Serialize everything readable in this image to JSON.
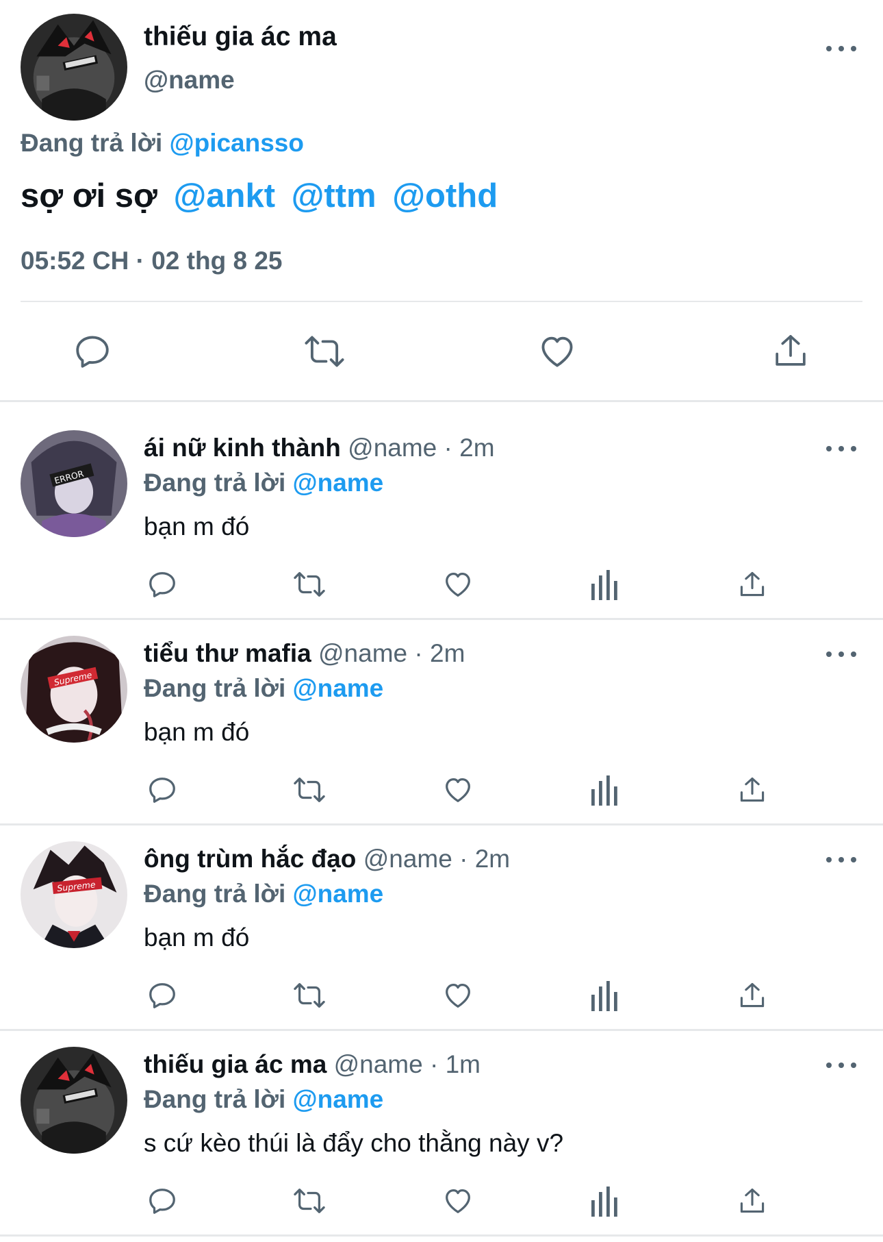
{
  "main_tweet": {
    "author_name": "thiếu gia ác ma",
    "author_handle": "@name",
    "replying_label": "Đang trả lời",
    "replying_to": "@picansso",
    "text_prefix": "sợ ơi sợ",
    "mentions": [
      "@ankt",
      "@ttm",
      "@othd"
    ],
    "timestamp": "05:52 CH · 02 thg 8 25",
    "avatar_icon": "avatar-anime-boy-dark",
    "actions": [
      "reply-icon",
      "retweet-icon",
      "like-icon",
      "share-icon"
    ]
  },
  "replies": [
    {
      "name": "ái nữ kinh thành",
      "handle": "@name",
      "time": "2m",
      "replying_label": "Đang trả lời",
      "replying_to": "@name",
      "text": "bạn m đó",
      "avatar_icon": "avatar-anime-girl-error"
    },
    {
      "name": "tiểu thư mafia",
      "handle": "@name",
      "time": "2m",
      "replying_label": "Đang trả lời",
      "replying_to": "@name",
      "text": "bạn m đó",
      "avatar_icon": "avatar-anime-girl-supreme"
    },
    {
      "name": "ông trùm hắc đạo",
      "handle": "@name",
      "time": "2m",
      "replying_label": "Đang trả lời",
      "replying_to": "@name",
      "text": "bạn m đó",
      "avatar_icon": "avatar-anime-boy-supreme"
    },
    {
      "name": "thiếu gia ác ma",
      "handle": "@name",
      "time": "1m",
      "replying_label": "Đang trả lời",
      "replying_to": "@name",
      "text": "s cứ kèo thúi là đẩy cho thằng này v?",
      "avatar_icon": "avatar-anime-boy-dark"
    }
  ],
  "meta_separator": "·",
  "colors": {
    "accent": "#1d9bf0",
    "text": "#0f1419",
    "secondary": "#536471",
    "divider": "#e6e8ea"
  }
}
